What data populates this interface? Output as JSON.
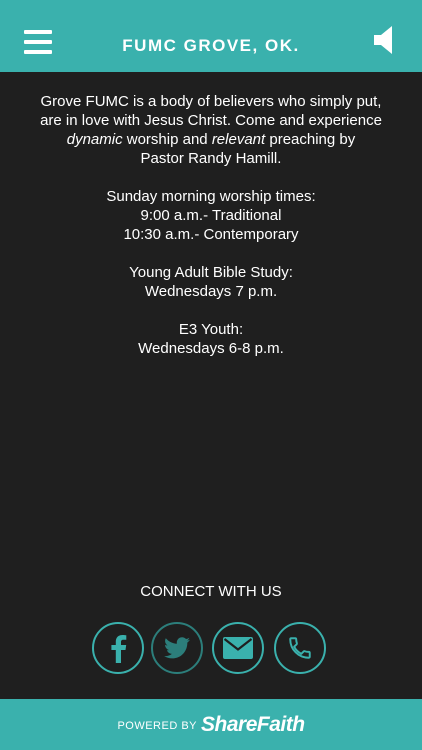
{
  "header": {
    "title": "FUMC GROVE, OK.",
    "menu_icon": "hamburger-menu-icon",
    "sound_icon": "speaker-icon"
  },
  "content": {
    "intro_line1": "Grove FUMC is a body of believers who simply put,",
    "intro_line2": "are in love with Jesus Christ. Come and experience",
    "intro_word_dynamic": "dynamic",
    "intro_text_worship": " worship and ",
    "intro_word_relevant": "relevant",
    "intro_text_preaching": " preaching by",
    "intro_line4": "Pastor Randy Hamill.",
    "worship_heading": "Sunday morning worship times:",
    "worship_time1": "9:00 a.m.- Traditional",
    "worship_time2": "10:30 a.m.- Contemporary",
    "bible_heading": "Young Adult Bible Study:",
    "bible_time": "Wednesdays 7 p.m.",
    "youth_heading": "E3 Youth:",
    "youth_time": "Wednesdays 6-8 p.m."
  },
  "connect": {
    "heading": "CONNECT WITH US",
    "icons": [
      "facebook-icon",
      "twitter-icon",
      "email-icon",
      "phone-icon"
    ]
  },
  "footer": {
    "powered_by": "POWERED BY",
    "brand": "ShareFaith"
  },
  "colors": {
    "accent": "#3ab1ad",
    "background": "#1f1f1f",
    "text": "#ffffff"
  }
}
